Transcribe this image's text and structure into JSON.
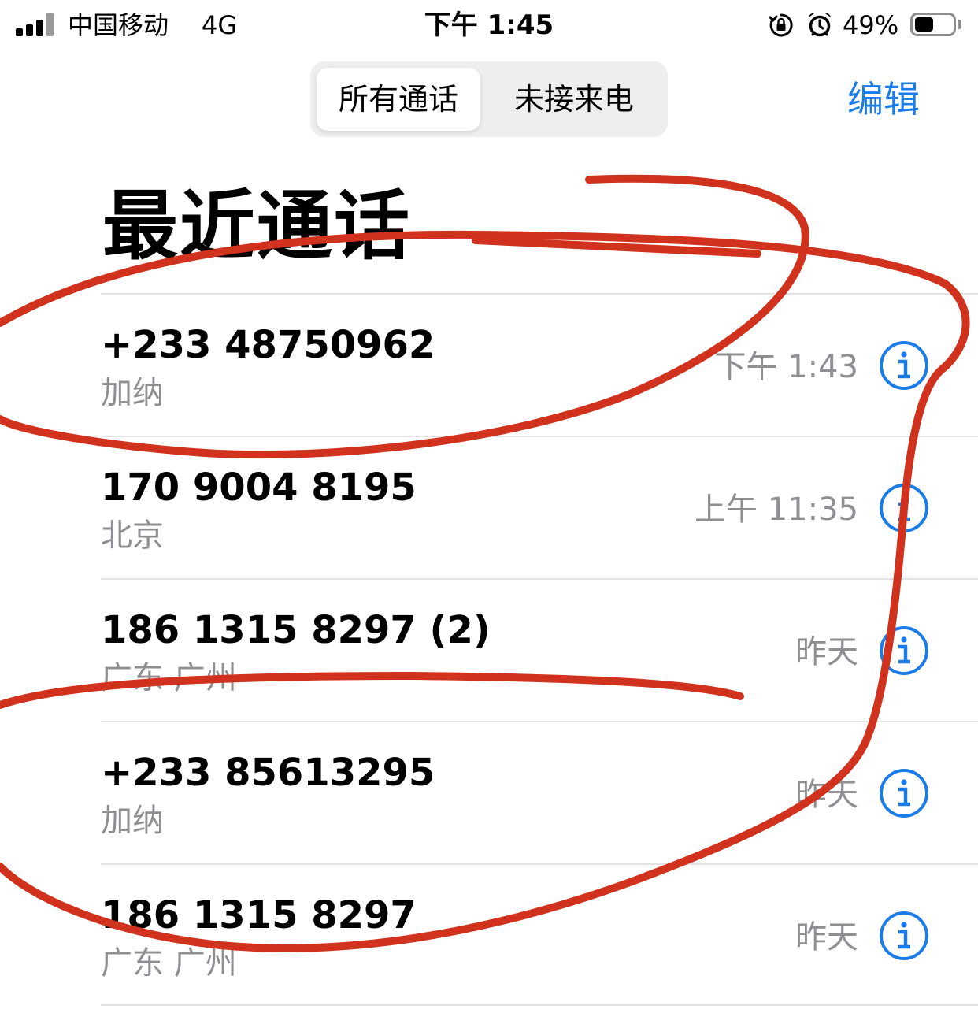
{
  "status_bar": {
    "carrier": "中国移动",
    "network": "4G",
    "time": "下午 1:45",
    "battery_percent": "49%",
    "battery_level": 0.49,
    "icons": [
      "signal-icon",
      "rotation-lock-icon",
      "alarm-icon",
      "battery-icon"
    ]
  },
  "segmented": {
    "all_label": "所有通话",
    "missed_label": "未接来电",
    "selected": "all"
  },
  "toolbar": {
    "edit_label": "编辑"
  },
  "title": "最近通话",
  "calls": [
    {
      "number": "+233 48750962",
      "location": "加纳",
      "time": "下午 1:43"
    },
    {
      "number": "170 9004 8195",
      "location": "北京",
      "time": "上午 11:35"
    },
    {
      "number": "186 1315 8297 (2)",
      "location": "广东 广州",
      "time": "昨天"
    },
    {
      "number": "+233 85613295",
      "location": "加纳",
      "time": "昨天"
    },
    {
      "number": "186 1315 8297",
      "location": "广东 广州",
      "time": "昨天"
    }
  ],
  "colors": {
    "accent": "#1a7ce9",
    "secondary_text": "#8e8e93",
    "separator": "#e3e3e5",
    "markup_red": "#d0321e"
  }
}
